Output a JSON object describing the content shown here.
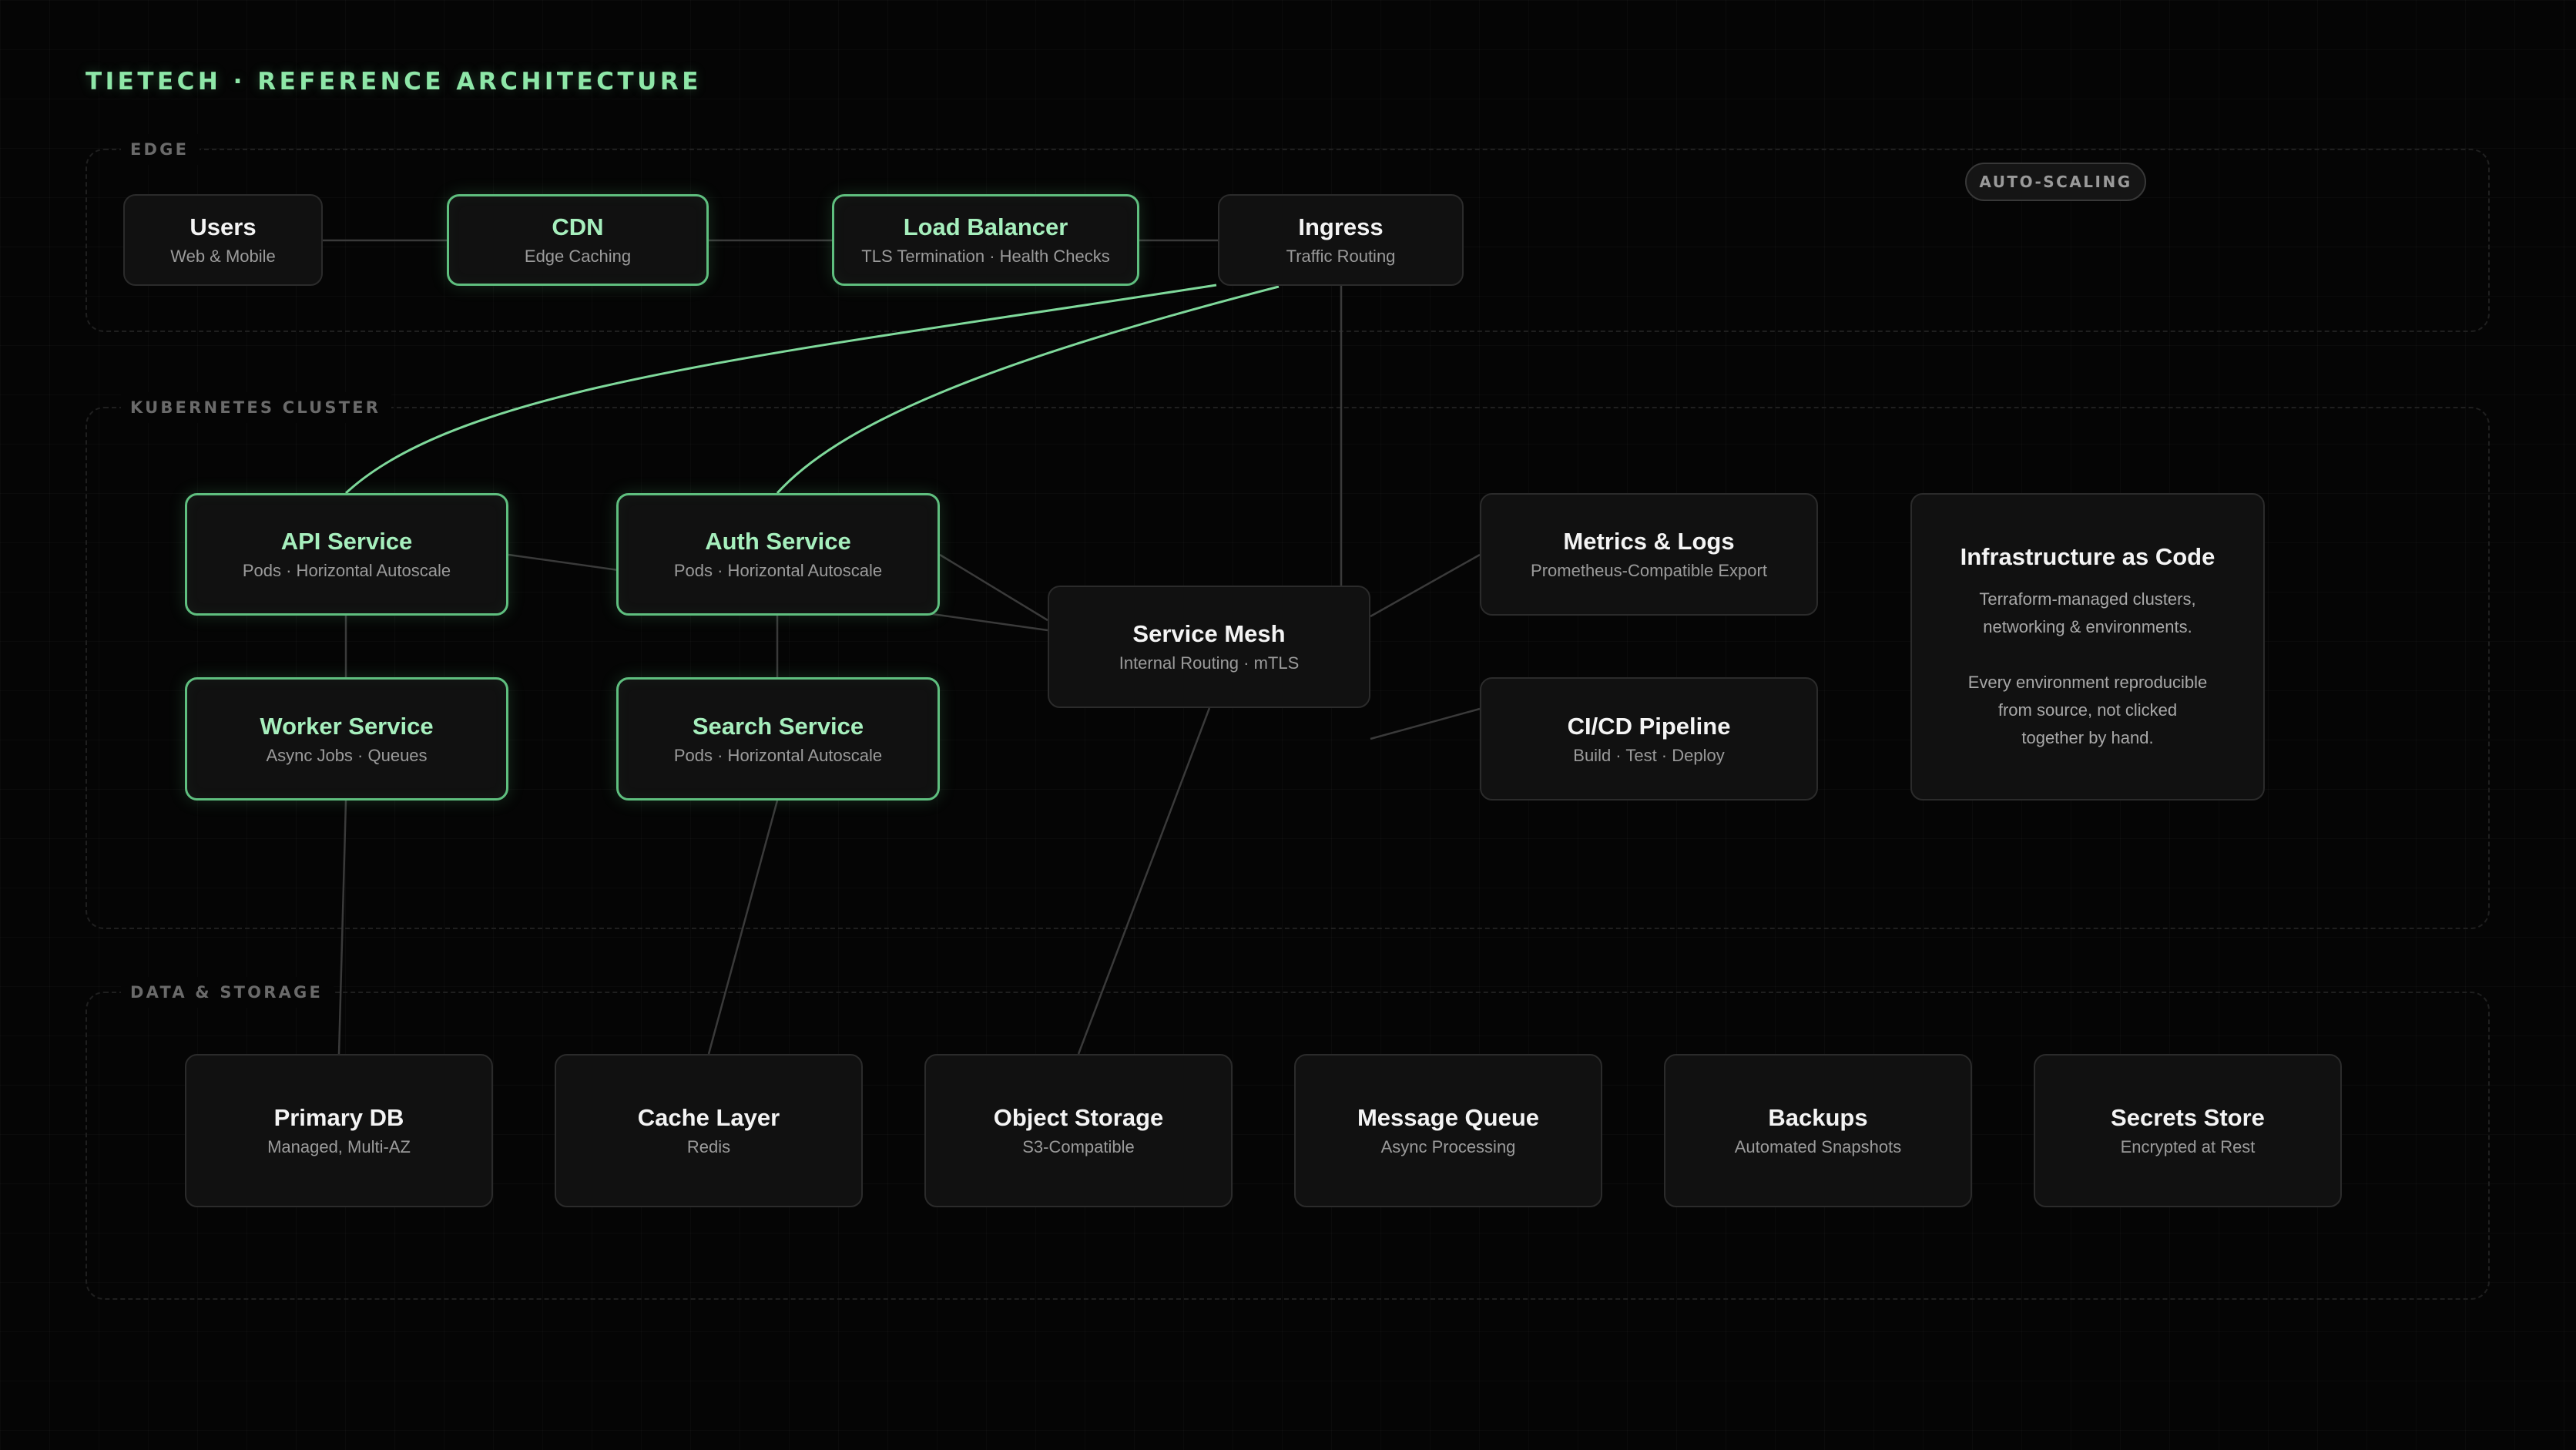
{
  "title": "TIETECH · REFERENCE ARCHITECTURE",
  "badge": "AUTO-SCALING",
  "sections": {
    "edge": "EDGE",
    "cluster": "KUBERNETES CLUSTER",
    "data": "DATA & STORAGE"
  },
  "nodes": {
    "users": {
      "name": "Users",
      "sub": "Web & Mobile"
    },
    "cdn": {
      "name": "CDN",
      "sub": "Edge Caching"
    },
    "lb": {
      "name": "Load Balancer",
      "sub": "TLS Termination · Health Checks"
    },
    "ingress": {
      "name": "Ingress",
      "sub": "Traffic Routing"
    },
    "api": {
      "name": "API Service",
      "sub": "Pods · Horizontal Autoscale"
    },
    "auth": {
      "name": "Auth Service",
      "sub": "Pods · Horizontal Autoscale"
    },
    "worker": {
      "name": "Worker Service",
      "sub": "Async Jobs · Queues"
    },
    "search": {
      "name": "Search Service",
      "sub": "Pods · Horizontal Autoscale"
    },
    "mesh": {
      "name": "Service Mesh",
      "sub": "Internal Routing · mTLS"
    },
    "metrics": {
      "name": "Metrics & Logs",
      "sub": "Prometheus-Compatible Export"
    },
    "cicd": {
      "name": "CI/CD Pipeline",
      "sub": "Build · Test · Deploy"
    },
    "iac": {
      "name": "Infrastructure as Code",
      "sub": "Terraform-managed clusters,\nnetworking & environments.\n\nEvery environment reproducible\nfrom source, not clicked\ntogether by hand."
    },
    "db": {
      "name": "Primary DB",
      "sub": "Managed, Multi-AZ"
    },
    "cache": {
      "name": "Cache Layer",
      "sub": "Redis"
    },
    "objects": {
      "name": "Object Storage",
      "sub": "S3-Compatible"
    },
    "queue": {
      "name": "Message Queue",
      "sub": "Async Processing"
    },
    "backups": {
      "name": "Backups",
      "sub": "Automated Snapshots"
    },
    "secrets": {
      "name": "Secrets Store",
      "sub": "Encrypted at Rest"
    }
  },
  "colors": {
    "accent": "#8ee7a8",
    "accent_border": "#5fbf7f",
    "background": "#050505",
    "node_fill": "#111111"
  }
}
